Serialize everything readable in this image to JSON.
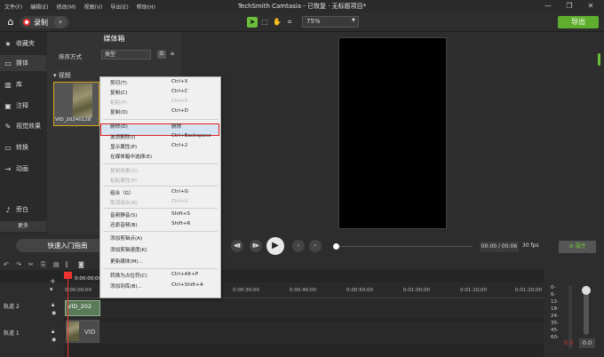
{
  "menubar": {
    "items": [
      "文件(F)",
      "编辑(E)",
      "修改(M)",
      "视图(V)",
      "导出(E)",
      "帮助(H)"
    ]
  },
  "window": {
    "title": "TechSmith Camtasia - 已恢复 · 无标题项目*",
    "min": "—",
    "max": "❐",
    "close": "✕"
  },
  "toolbar": {
    "record_label": "录制",
    "zoom": "75%",
    "export_label": "导出",
    "home_icon": "⌂"
  },
  "sidebar": {
    "items": [
      {
        "label": "收藏夹",
        "icon": "★"
      },
      {
        "label": "媒体",
        "icon": "▭"
      },
      {
        "label": "库",
        "icon": "▥"
      },
      {
        "label": "注释",
        "icon": "▣"
      },
      {
        "label": "视觉效果",
        "icon": "✎"
      },
      {
        "label": "转换",
        "icon": "▭"
      },
      {
        "label": "动画",
        "icon": "→"
      },
      {
        "label": "旁白",
        "icon": "♪"
      }
    ],
    "more_label": "更多",
    "add_label": "+"
  },
  "bin": {
    "title": "媒体箱",
    "sort_label": "排序方式",
    "sort_value": "类型",
    "videos_header": "▾ 视频",
    "thumb_caption": "VID_20240128"
  },
  "context_menu": {
    "items": [
      {
        "label": "剪切(T)",
        "shortcut": "Ctrl+X",
        "disabled": false
      },
      {
        "label": "复制(C)",
        "shortcut": "Ctrl+C",
        "disabled": false
      },
      {
        "label": "粘贴(P)",
        "shortcut": "Ctrl+V",
        "disabled": true
      },
      {
        "label": "复制(D)",
        "shortcut": "Ctrl+D",
        "disabled": false
      },
      {
        "label": "删除(D)",
        "shortcut": "删除",
        "disabled": false
      },
      {
        "label": "波浪删除(I)",
        "shortcut": "Ctrl+Backspace",
        "disabled": false
      },
      {
        "label": "显示属性(P)",
        "shortcut": "Ctrl+2",
        "disabled": false
      },
      {
        "label": "在媒体箱中选择(E)",
        "shortcut": "",
        "disabled": false
      },
      {
        "label": "复制效果(O)",
        "shortcut": "",
        "disabled": true
      },
      {
        "label": "粘贴属性(P)",
        "shortcut": "",
        "disabled": true
      },
      {
        "label": "组合（G）",
        "shortcut": "Ctrl+G",
        "disabled": false
      },
      {
        "label": "取消组合(N)",
        "shortcut": "Ctrl+U",
        "disabled": true
      },
      {
        "label": "音频静音(S)",
        "shortcut": "Shift+S",
        "disabled": false
      },
      {
        "label": "还原音频(B)",
        "shortcut": "Shift+R",
        "disabled": false
      },
      {
        "label": "添加剪辑点(A)",
        "shortcut": "",
        "disabled": false
      },
      {
        "label": "添加剪辑速度(K)",
        "shortcut": "",
        "disabled": false
      },
      {
        "label": "更新媒体(M)...",
        "shortcut": "",
        "disabled": false
      },
      {
        "label": "转换为占位符(C)",
        "shortcut": "Ctrl+Alt+P",
        "disabled": false
      },
      {
        "label": "添加到库(B)...",
        "shortcut": "Ctrl+Shift+A",
        "disabled": false
      }
    ]
  },
  "player": {
    "quick_guide": "快速入门指南",
    "time": "00:00 / 00:06",
    "fps": "30 fps",
    "properties": "⚙ 属性"
  },
  "timeline": {
    "playhead_time": "0:00:00;00",
    "ticks": [
      "0:00:00;00",
      "0:00:30;00",
      "0:00:40;00",
      "0:00:50;00",
      "0:01:00;00",
      "0:01:10;00",
      "0:01:20;00"
    ],
    "track2_label": "轨道 2",
    "track1_label": "轨道 1",
    "clip2_label": "VID_202",
    "clip1_label": "VID"
  },
  "meter": {
    "labels": [
      "0-",
      "6-",
      "12-",
      "18-",
      "24-",
      "35-",
      "45-",
      "60-"
    ],
    "vol_left": "0.0",
    "vol_right": "0.0"
  }
}
